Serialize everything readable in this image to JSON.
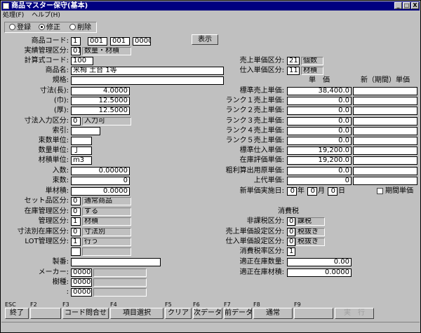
{
  "window": {
    "title": "商品マスター保守(基本)",
    "menu": [
      "処理(F)",
      "ヘルプ(H)"
    ],
    "controls": [
      "_",
      "□",
      "X"
    ]
  },
  "mode": {
    "options": [
      "登録",
      "修正",
      "削除"
    ],
    "selected": 1
  },
  "left": [
    {
      "label": "商品コード:",
      "fields": [
        {
          "v": "1"
        },
        {
          "v": "001"
        },
        {
          "v": "001"
        },
        {
          "v": "0000"
        }
      ]
    },
    {
      "label": "実績管理区分:",
      "fields": [
        {
          "v": "01"
        },
        {
          "v": "数量・材積",
          "g": true
        }
      ]
    },
    {
      "label": "計算式コード:",
      "fields": [
        {
          "v": "100"
        }
      ]
    },
    {
      "label": "商品名:",
      "fields": [
        {
          "v": "米栂              土台              1等"
        }
      ]
    },
    {
      "label": "規格:",
      "fields": [
        {
          "v": ""
        }
      ]
    },
    {
      "label": "寸法(長):",
      "fields": [
        {
          "v": "4.0000"
        }
      ]
    },
    {
      "label": "(巾):",
      "fields": [
        {
          "v": "12.5000"
        }
      ]
    },
    {
      "label": "(厚):",
      "fields": [
        {
          "v": "12.5000"
        }
      ]
    },
    {
      "label": "寸法入力区分:",
      "fields": [
        {
          "v": "0"
        },
        {
          "v": "入力可",
          "g": true
        }
      ]
    },
    {
      "label": "索引:",
      "fields": [
        {
          "v": ""
        }
      ]
    },
    {
      "label": "束数単位:",
      "fields": [
        {
          "v": ""
        }
      ]
    },
    {
      "label": "数量単位:",
      "fields": [
        {
          "v": "丁"
        }
      ]
    },
    {
      "label": "材積単位:",
      "fields": [
        {
          "v": "m3"
        }
      ]
    },
    {
      "label": "入数:",
      "fields": [
        {
          "v": "0.00000"
        }
      ]
    },
    {
      "label": "束数:",
      "fields": [
        {
          "v": "0"
        }
      ]
    },
    {
      "label": "単材積:",
      "fields": [
        {
          "v": "0.0000"
        }
      ]
    },
    {
      "label": "セット品区分:",
      "fields": [
        {
          "v": "0"
        },
        {
          "v": "通常商品",
          "g": true
        }
      ]
    },
    {
      "label": "在庫管理区分:",
      "fields": [
        {
          "v": "0"
        },
        {
          "v": "する",
          "g": true
        }
      ]
    },
    {
      "label": "管理区分:",
      "fields": [
        {
          "v": "1"
        },
        {
          "v": "材積",
          "g": true
        }
      ]
    },
    {
      "label": "寸法別在庫区分:",
      "fields": [
        {
          "v": "0"
        },
        {
          "v": "寸法別",
          "g": true
        }
      ]
    },
    {
      "label": "LOT管理区分:",
      "fields": [
        {
          "v": "1"
        },
        {
          "v": "行う",
          "g": true
        }
      ]
    },
    {
      "label": "",
      "fields": [
        {
          "v": ""
        },
        {
          "v": "",
          "g": true
        }
      ]
    },
    {
      "label": "製番:",
      "fields": [
        {
          "v": ""
        }
      ]
    },
    {
      "label": "メーカー:",
      "fields": [
        {
          "v": "0000"
        },
        {
          "v": "",
          "g": true
        }
      ]
    },
    {
      "label": "樹種:",
      "fields": [
        {
          "v": "0000"
        },
        {
          "v": "",
          "g": true
        }
      ]
    },
    {
      "label": ":",
      "fields": [
        {
          "v": "0000"
        },
        {
          "v": "",
          "g": true
        }
      ]
    }
  ],
  "show_button": "表示",
  "right_top": [
    {
      "label": "売上単価区分:",
      "code": "21",
      "text": "個数"
    },
    {
      "label": "仕入単価区分:",
      "code": "11",
      "text": "材積"
    }
  ],
  "price_headers": [
    "単　価",
    "新（期間）単価"
  ],
  "prices": [
    {
      "label": "標準売上単価:",
      "v": "38,400.0"
    },
    {
      "label": "ランク１売上単価:",
      "v": "0.0"
    },
    {
      "label": "ランク２売上単価:",
      "v": "0.0"
    },
    {
      "label": "ランク３売上単価:",
      "v": "0.0"
    },
    {
      "label": "ランク４売上単価:",
      "v": "0.0"
    },
    {
      "label": "ランク５売上単価:",
      "v": "0.0"
    },
    {
      "label": "標準仕入単価:",
      "v": "19,200.0"
    },
    {
      "label": "在庫評価単価:",
      "v": "19,200.0"
    },
    {
      "label": "粗利算出用原単価:",
      "v": "0.0"
    },
    {
      "label": "上代単価:",
      "v": "0"
    }
  ],
  "new_price_date": {
    "label": "新単価実施日:",
    "year": "0",
    "year_unit": "年",
    "month": "0",
    "month_unit": "月",
    "day": "0",
    "day_unit": "日",
    "period_label": "期間単価"
  },
  "tax": {
    "header": "消費税",
    "rows": [
      {
        "label": "非課税区分:",
        "code": "0",
        "text": "課税"
      },
      {
        "label": "売上単価設定区分:",
        "code": "0",
        "text": "税抜き"
      },
      {
        "label": "仕入単価設定区分:",
        "code": "0",
        "text": "税抜き"
      },
      {
        "label": "消費税率区分:",
        "code": "1",
        "text": ""
      }
    ]
  },
  "proper_stock": [
    {
      "label": "適正在庫数量:",
      "v": "0.00"
    },
    {
      "label": "適正在庫材積:",
      "v": "0.0000"
    }
  ],
  "fkeys": [
    {
      "key": "ESC",
      "label": "終了",
      "en": true
    },
    {
      "key": "F2",
      "label": "",
      "en": false
    },
    {
      "key": "F3",
      "label": "コード問合せ",
      "en": true
    },
    {
      "key": "F4",
      "label": "項目選択",
      "en": true
    },
    {
      "key": "F5",
      "label": "クリア",
      "en": true
    },
    {
      "key": "F6",
      "label": "次データ",
      "en": true
    },
    {
      "key": "F7",
      "label": "前データ",
      "en": true
    },
    {
      "key": "F8",
      "label": "通常",
      "en": true
    },
    {
      "key": "F9",
      "label": "",
      "en": false
    },
    {
      "key": "",
      "label": "実　行",
      "en": false
    }
  ]
}
